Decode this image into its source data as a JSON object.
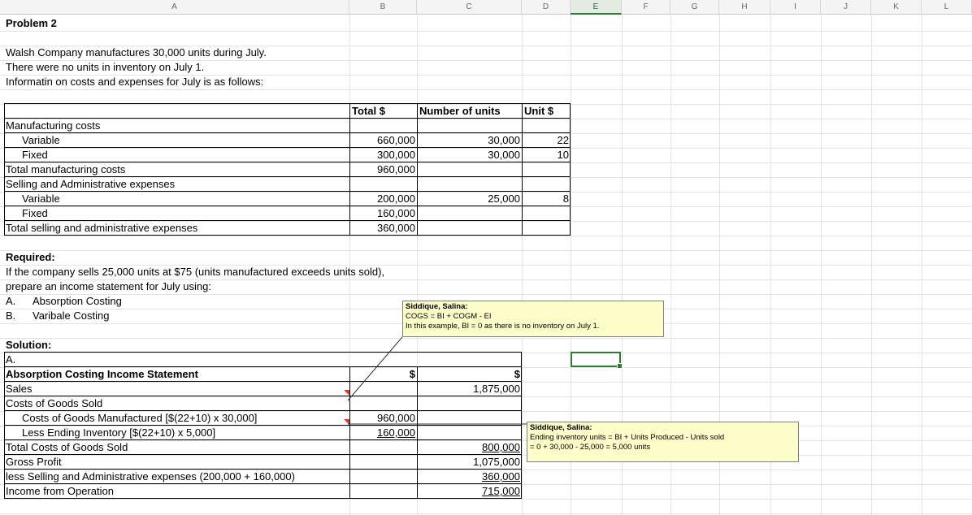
{
  "columns": [
    "A",
    "B",
    "C",
    "D",
    "E",
    "F",
    "G",
    "H",
    "I",
    "J",
    "K",
    "L"
  ],
  "selected_column": "E",
  "problem_title": "Problem 2",
  "intro": [
    "Walsh Company manufactures 30,000 units during July.",
    "There were no units in inventory on July 1.",
    "Informatin on costs and expenses for July is as follows:"
  ],
  "cost_table": {
    "headers": [
      "Total $",
      "Number of units",
      "Unit $"
    ],
    "rows": [
      {
        "label": "Manufacturing costs",
        "indent": false,
        "total": "",
        "units": "",
        "unit": ""
      },
      {
        "label": "Variable",
        "indent": true,
        "total": "660,000",
        "units": "30,000",
        "unit": "22"
      },
      {
        "label": "Fixed",
        "indent": true,
        "total": "300,000",
        "units": "30,000",
        "unit": "10"
      },
      {
        "label": "Total manufacturing costs",
        "indent": false,
        "total": "960,000",
        "units": "",
        "unit": ""
      },
      {
        "label": "Selling and Administrative expenses",
        "indent": false,
        "total": "",
        "units": "",
        "unit": ""
      },
      {
        "label": "Variable",
        "indent": true,
        "total": "200,000",
        "units": "25,000",
        "unit": "8"
      },
      {
        "label": "Fixed",
        "indent": true,
        "total": "160,000",
        "units": "",
        "unit": ""
      },
      {
        "label": "Total selling and administrative expenses",
        "indent": false,
        "total": "360,000",
        "units": "",
        "unit": ""
      }
    ]
  },
  "required": {
    "heading": "Required:",
    "line1": "If the company sells 25,000 units at $75 (units manufactured exceeds units sold),",
    "line2": "prepare an income statement for July using:",
    "items": [
      {
        "letter": "A.",
        "text": "Absorption Costing"
      },
      {
        "letter": "B.",
        "text": "Varibale Costing"
      }
    ]
  },
  "solution": {
    "heading": "Solution:",
    "part": "A.",
    "statement_title": "Absorption Costing Income Statement",
    "col_b_header": "$",
    "col_c_header": "$",
    "rows": [
      {
        "label": "Sales",
        "b": "",
        "c": "1,875,000",
        "indent": false
      },
      {
        "label": "Costs of Goods Sold",
        "b": "",
        "c": "",
        "indent": false
      },
      {
        "label": "Costs of Goods Manufactured [$(22+10) x 30,000]",
        "b": "960,000",
        "c": "",
        "indent": true
      },
      {
        "label": "Less Ending Inventory [$(22+10) x 5,000]",
        "b": "160,000",
        "c": "",
        "indent": true
      },
      {
        "label": "Total Costs of Goods Sold",
        "b": "",
        "c": "800,000",
        "indent": false
      },
      {
        "label": "Gross Profit",
        "b": "",
        "c": "1,075,000",
        "indent": false
      },
      {
        "label": "less Selling and Administrative expenses (200,000 + 160,000)",
        "b": "",
        "c": "360,000",
        "indent": false
      },
      {
        "label": "Income from Operation",
        "b": "",
        "c": "715,000",
        "indent": false
      }
    ]
  },
  "comments": [
    {
      "author": "Siddique, Salina:",
      "lines": [
        "COGS = BI + COGM - EI",
        "In this example, BI = 0 as there is no inventory on July 1."
      ]
    },
    {
      "author": "Siddique, Salina:",
      "lines": [
        "Ending inventory units = BI + Units Produced - Units sold",
        "= 0 + 30,000 - 25,000 = 5,000 units"
      ]
    }
  ]
}
